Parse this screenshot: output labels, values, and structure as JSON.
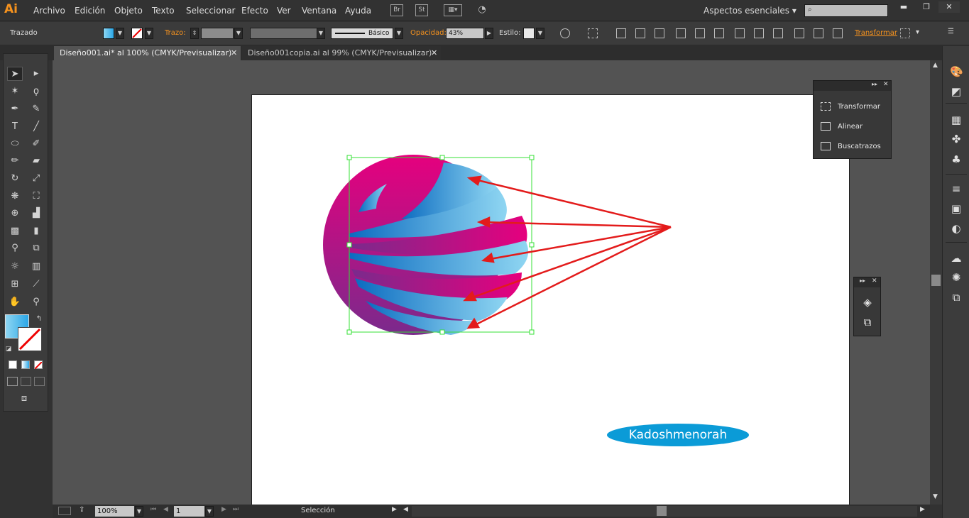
{
  "app": {
    "logo": "Ai"
  },
  "menu": [
    "Archivo",
    "Edición",
    "Objeto",
    "Texto",
    "Seleccionar",
    "Efecto",
    "Ver",
    "Ventana",
    "Ayuda"
  ],
  "menubar_icons": {
    "bridge": "Br",
    "stock": "St"
  },
  "workspace": "Aspectos esenciales",
  "control": {
    "object_type": "Trazado",
    "stroke_label": "Trazo:",
    "brush_label": "Básico",
    "opacity_label": "Opacidad:",
    "opacity_value": "43%",
    "style_label": "Estilo:",
    "transform_label": "Transformar",
    "fill_color": "#2aa7e8",
    "accent_color": "#f7931e"
  },
  "tabs": [
    {
      "label": "Diseño001.ai* al 100% (CMYK/Previsualizar)",
      "active": true
    },
    {
      "label": "Diseño001copia.ai al 99% (CMYK/Previsualizar)",
      "active": false
    }
  ],
  "float_panel": {
    "items": [
      "Transformar",
      "Alinear",
      "Buscatrazos"
    ]
  },
  "status": {
    "zoom": "100%",
    "page": "1",
    "tool": "Selección"
  },
  "artwork": {
    "brand_text": "Kadoshmenorah",
    "brand_color": "#0b9bd7",
    "arrow_color": "#e31b1b",
    "selection_color": "#35e035",
    "gradient_magenta": "#e6007e",
    "gradient_purple": "#7a2a8c",
    "gradient_blue": "#0b6bc0",
    "gradient_light": "#8fd6f2"
  }
}
